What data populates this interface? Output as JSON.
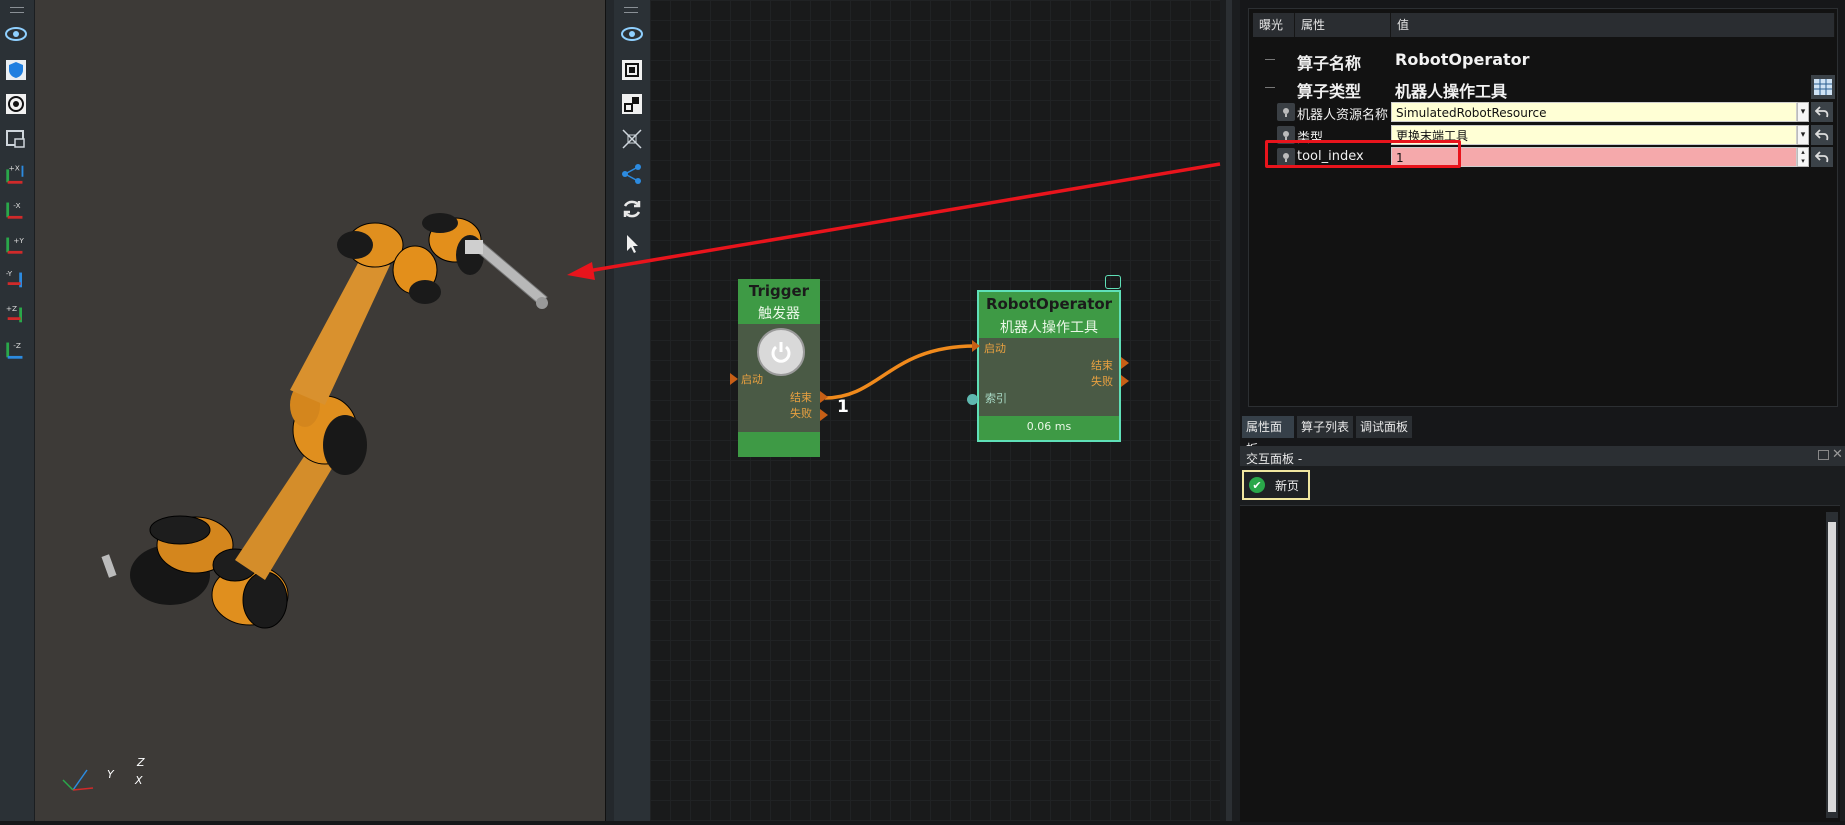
{
  "viewport": {
    "axis_labels": {
      "x": "X",
      "y": "Y",
      "z": "Z"
    }
  },
  "left_toolbar": {
    "buttons": [
      {
        "icon": "eye-icon"
      },
      {
        "icon": "shield-icon"
      },
      {
        "icon": "target-icon"
      },
      {
        "icon": "camera-icon"
      },
      {
        "icon": "view-plus-x-icon",
        "label": "+X"
      },
      {
        "icon": "view-minus-x-icon",
        "label": "-X"
      },
      {
        "icon": "view-plus-y-icon",
        "label": "+Y"
      },
      {
        "icon": "view-minus-y-icon",
        "label": "-Y"
      },
      {
        "icon": "view-plus-z-icon",
        "label": "+Z"
      },
      {
        "icon": "view-minus-z-icon",
        "label": "-Z"
      }
    ]
  },
  "graph": {
    "trigger_node": {
      "title": "Trigger",
      "subtitle": "触发器",
      "input_port": "启动",
      "output_ports": [
        "结束",
        "失败"
      ]
    },
    "robot_node": {
      "title": "RobotOperator",
      "subtitle": "机器人操作工具",
      "input_port": "启动",
      "output_ports": [
        "结束",
        "失败"
      ],
      "index_port": "索引",
      "timing": "0.06 ms"
    },
    "connection_label": "1"
  },
  "property_panel": {
    "headers": {
      "expose": "曝光",
      "property": "属性",
      "value": "值"
    },
    "rows": {
      "operator_name": {
        "label": "算子名称",
        "value": "RobotOperator"
      },
      "operator_type": {
        "label": "算子类型",
        "value": "机器人操作工具"
      },
      "robot_resource": {
        "label": "机器人资源名称",
        "value": "SimulatedRobotResource"
      },
      "type": {
        "label": "类型",
        "value": "更换末端工具"
      },
      "tool_index": {
        "label": "tool_index",
        "value": "1"
      }
    }
  },
  "tabs": [
    "属性面板",
    "算子列表",
    "调试面板"
  ],
  "interaction_panel": {
    "title": "交互面板 -",
    "new_page_button": "新页"
  },
  "colors": {
    "highlight_red": "#e8141c",
    "node_green": "#3e9a45",
    "node_selected_border": "#5fe0b8",
    "connection_orange": "#f08a1c",
    "input_yellow": "#ffffd5",
    "input_error": "#f5a9ab"
  }
}
